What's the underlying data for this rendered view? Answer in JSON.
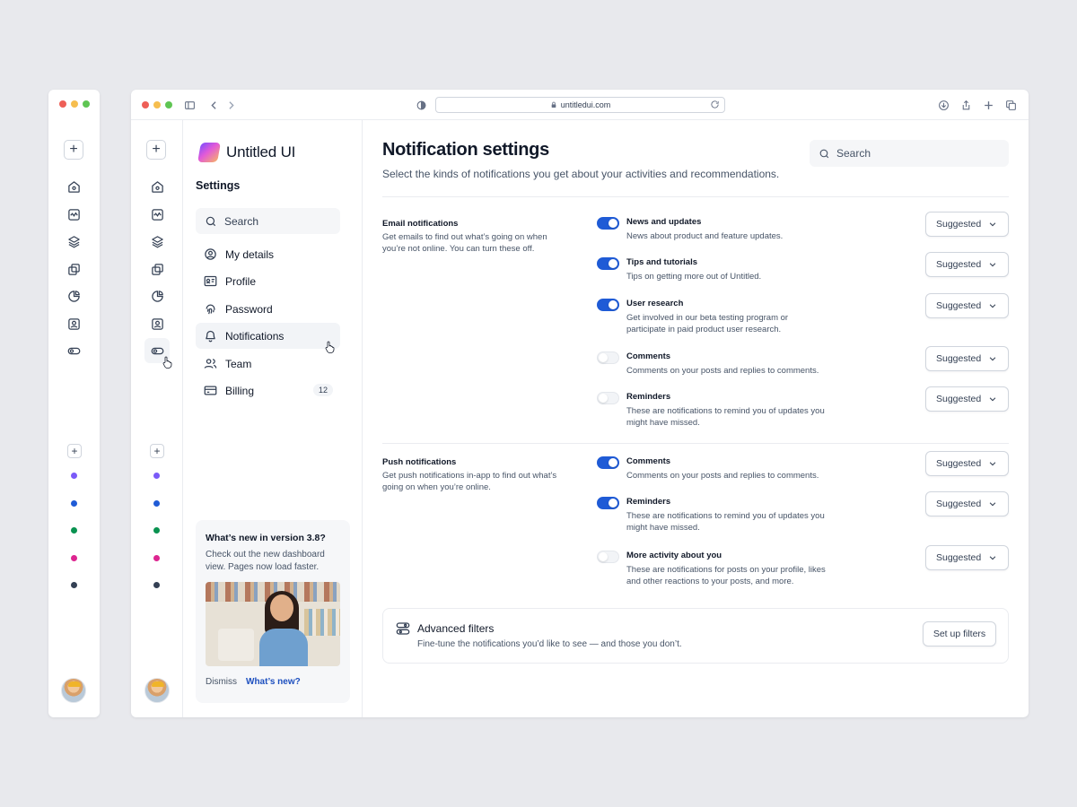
{
  "browser": {
    "url": "untitledui.com"
  },
  "app": {
    "name": "Untitled UI"
  },
  "sidebar": {
    "title": "Settings",
    "search_label": "Search",
    "items": [
      {
        "label": "My details",
        "icon": "user-circle-icon"
      },
      {
        "label": "Profile",
        "icon": "id-card-icon"
      },
      {
        "label": "Password",
        "icon": "fingerprint-icon"
      },
      {
        "label": "Notifications",
        "icon": "bell-icon",
        "active": true
      },
      {
        "label": "Team",
        "icon": "users-icon"
      },
      {
        "label": "Billing",
        "icon": "credit-card-icon",
        "badge": "12"
      }
    ],
    "whats_new": {
      "title": "What’s new in version 3.8?",
      "text": "Check out the new dashboard view. Pages now load faster.",
      "dismiss_label": "Dismiss",
      "link_label": "What’s new?"
    }
  },
  "rail": {
    "icons": [
      "home-icon",
      "activity-icon",
      "layers-icon",
      "copy-icon",
      "pie-chart-icon",
      "user-square-icon",
      "toggle-icon"
    ],
    "dot_colors": [
      "#7a5af8",
      "#1f5bd6",
      "#099250",
      "#dd2590",
      "#344054"
    ]
  },
  "main": {
    "title": "Notification settings",
    "subtitle": "Select the kinds of notifications you get about your activities and recommendations.",
    "search_placeholder": "Search",
    "sections": [
      {
        "title": "Email notifications",
        "description": "Get emails to find out what’s going on when you’re not online. You can turn these off.",
        "rows": [
          {
            "title": "News and updates",
            "description": "News about product and feature updates.",
            "enabled": true,
            "select": "Suggested"
          },
          {
            "title": "Tips and tutorials",
            "description": "Tips on getting more out of Untitled.",
            "enabled": true,
            "select": "Suggested"
          },
          {
            "title": "User research",
            "description": "Get involved in our beta testing program or participate in paid product user research.",
            "enabled": true,
            "select": "Suggested"
          },
          {
            "title": "Comments",
            "description": "Comments on your posts and replies to comments.",
            "enabled": false,
            "select": "Suggested"
          },
          {
            "title": "Reminders",
            "description": "These are notifications to remind you of updates you might have missed.",
            "enabled": false,
            "select": "Suggested"
          }
        ]
      },
      {
        "title": "Push notifications",
        "description": "Get push notifications in-app to find out what’s going on when you’re online.",
        "rows": [
          {
            "title": "Comments",
            "description": "Comments on your posts and replies to comments.",
            "enabled": true,
            "select": "Suggested"
          },
          {
            "title": "Reminders",
            "description": "These are notifications to remind you of updates you might have missed.",
            "enabled": true,
            "select": "Suggested"
          },
          {
            "title": "More activity about you",
            "description": "These are notifications for posts on your profile, likes and other reactions to your posts, and more.",
            "enabled": false,
            "select": "Suggested"
          }
        ]
      }
    ],
    "advanced": {
      "title": "Advanced filters",
      "description": "Fine-tune the notifications you’d like to see — and those you don’t.",
      "button_label": "Set up filters"
    }
  }
}
